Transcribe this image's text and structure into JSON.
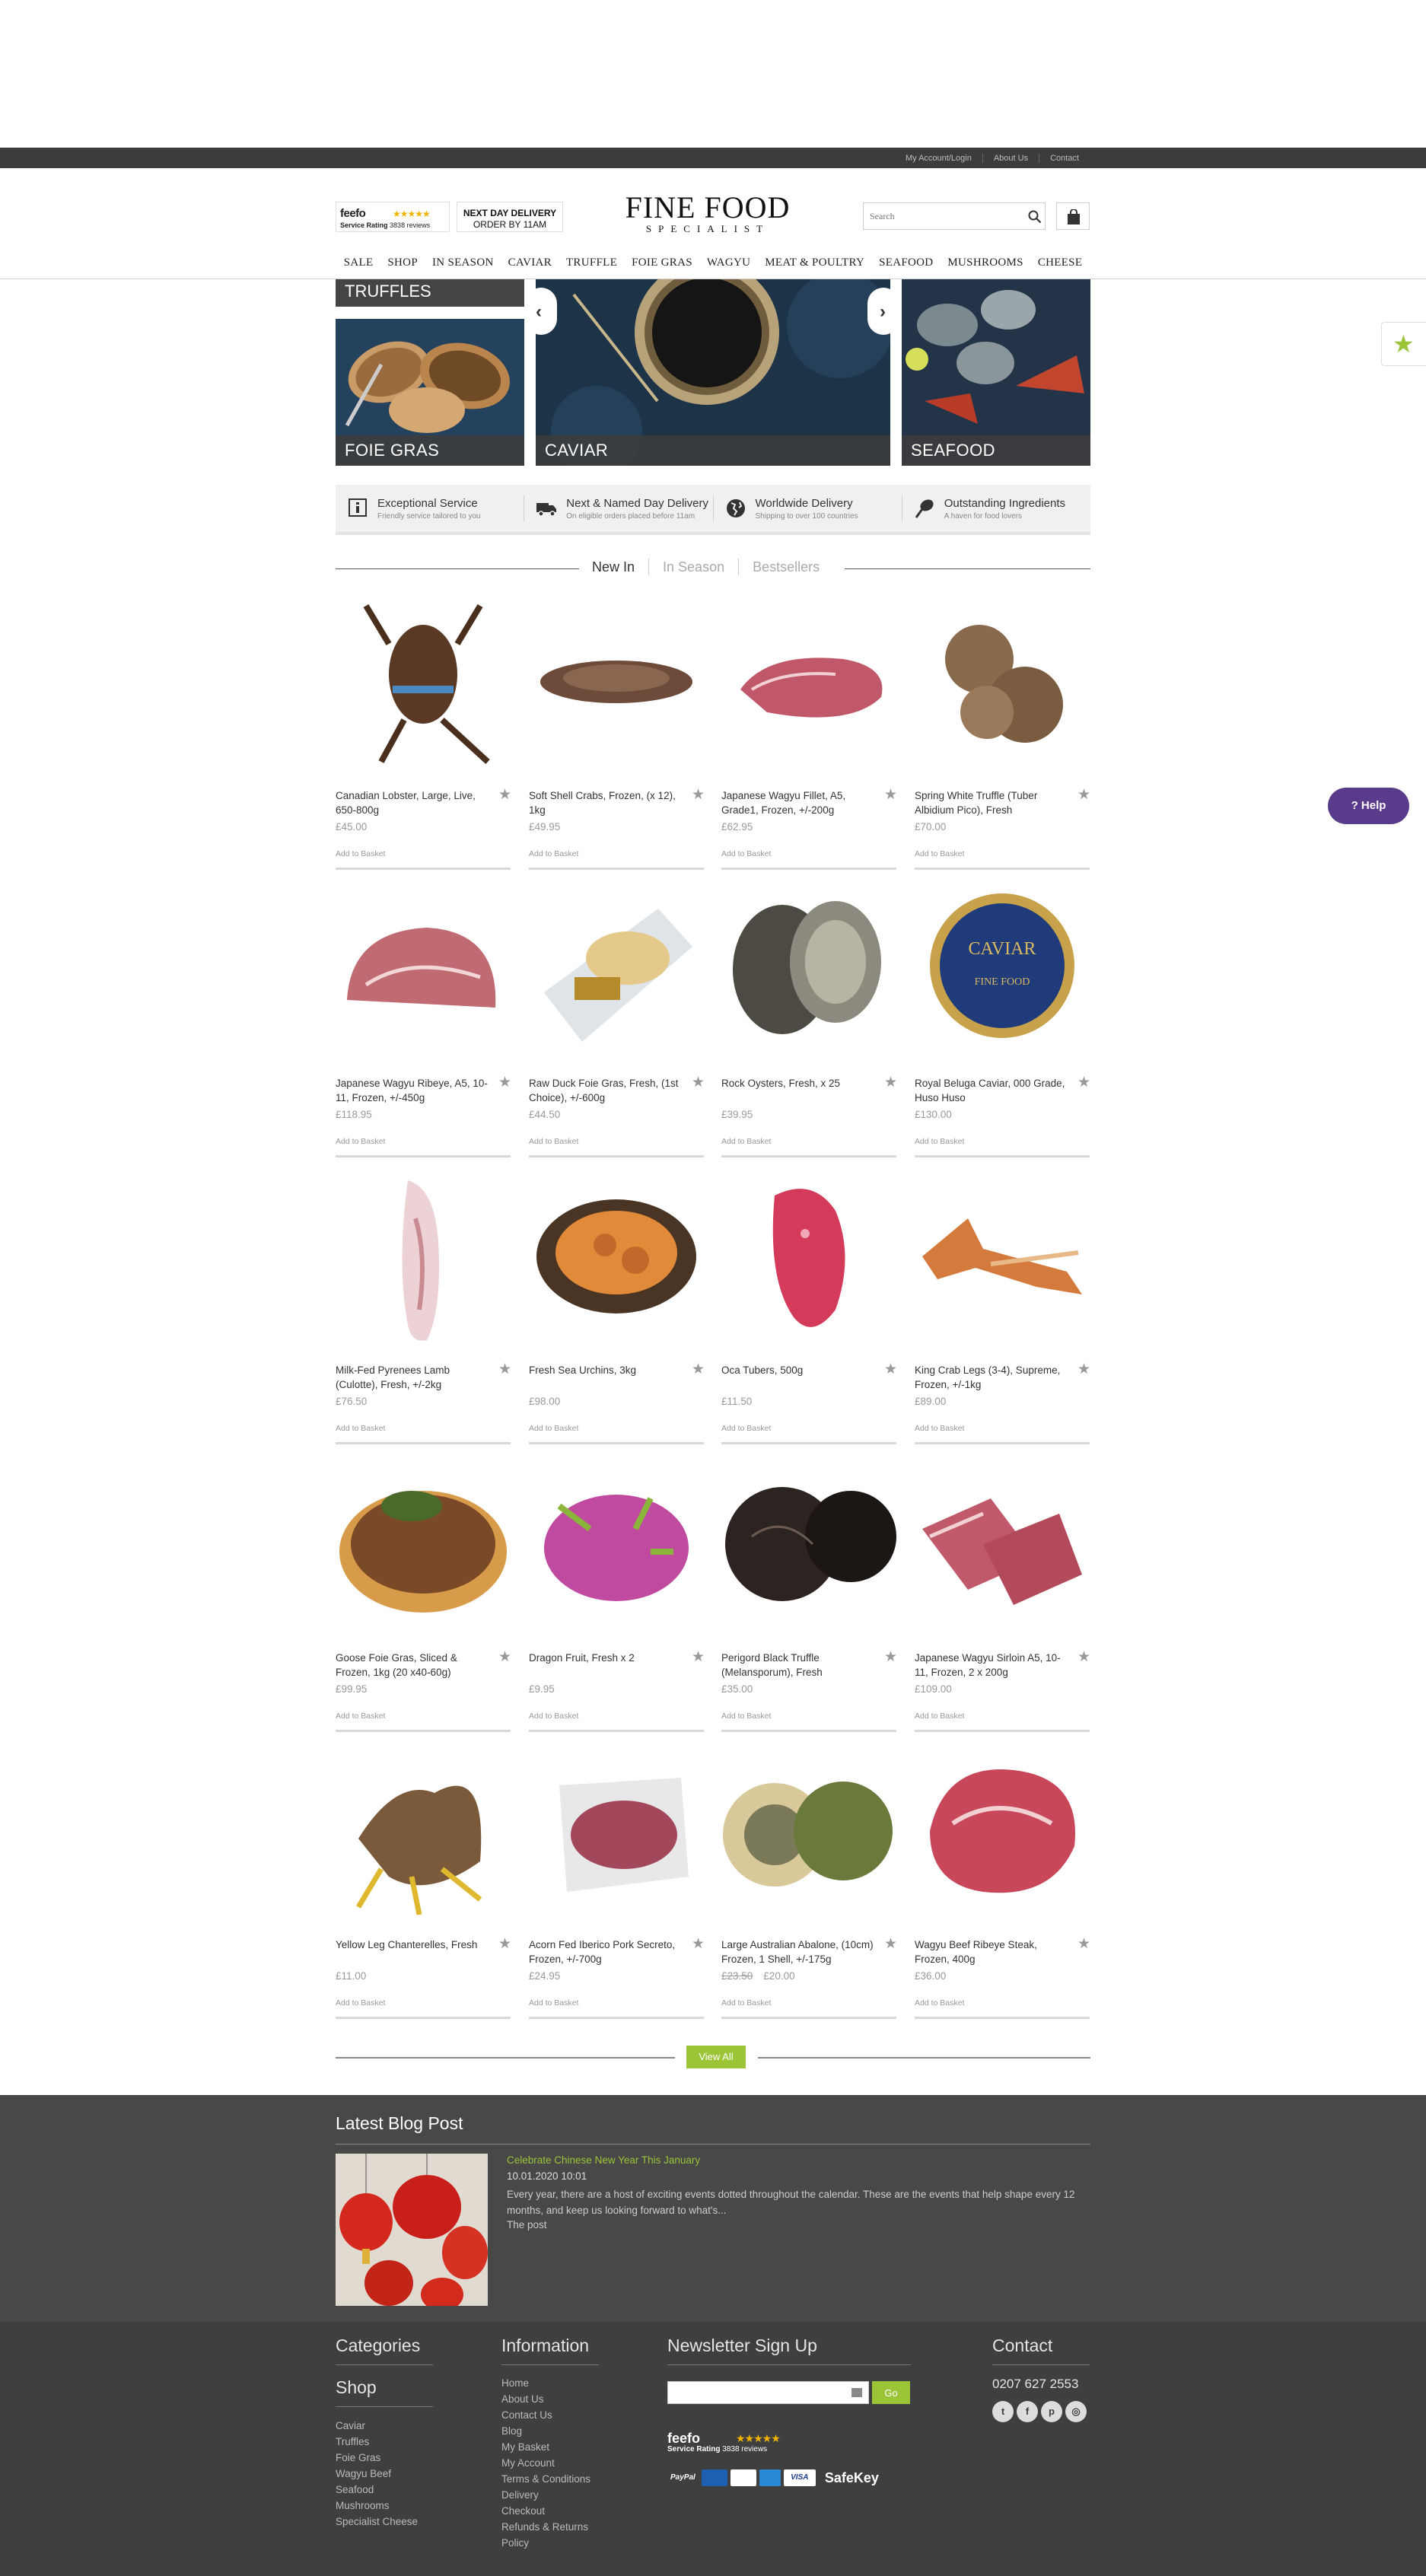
{
  "topbar": {
    "links": [
      "My Account/Login",
      "About Us",
      "Contact"
    ]
  },
  "header": {
    "feefo": {
      "logo": "feefo",
      "stars": "★★★★★",
      "rating": "Service Rating",
      "reviews": "3838 reviews"
    },
    "delivery": {
      "line1": "NEXT DAY DELIVERY",
      "line2": "ORDER BY 11AM"
    },
    "brand": {
      "name": "FINE FOOD",
      "sub": "SPECIALIST"
    },
    "search_placeholder": "Search"
  },
  "nav": [
    "SALE",
    "SHOP",
    "IN SEASON",
    "CAVIAR",
    "TRUFFLE",
    "FOIE GRAS",
    "WAGYU",
    "MEAT & POULTRY",
    "SEAFOOD",
    "MUSHROOMS",
    "CHEESE"
  ],
  "hero": {
    "truffles": "TRUFFLES",
    "foie": "FOIE GRAS",
    "caviar": "CAVIAR",
    "seafood": "SEAFOOD"
  },
  "usp": [
    {
      "title": "Exceptional Service",
      "sub": "Friendly service tailored to you",
      "icon": "info-icon"
    },
    {
      "title": "Next & Named Day Delivery",
      "sub": "On eligible orders placed before 11am",
      "icon": "truck-icon"
    },
    {
      "title": "Worldwide Delivery",
      "sub": "Shipping to over 100 countries",
      "icon": "globe-icon"
    },
    {
      "title": "Outstanding Ingredients",
      "sub": "A haven for food lovers",
      "icon": "whisk-icon"
    }
  ],
  "tabs": [
    "New In",
    "In Season",
    "Bestsellers"
  ],
  "products": [
    {
      "name": "Canadian Lobster, Large, Live, 650-800g",
      "price": "£45.00",
      "add": "Add to Basket"
    },
    {
      "name": "Soft Shell Crabs, Frozen, (x 12), 1kg",
      "price": "£49.95",
      "add": "Add to Basket"
    },
    {
      "name": "Japanese Wagyu Fillet, A5, Grade1, Frozen, +/-200g",
      "price": "£62.95",
      "add": "Add to Basket"
    },
    {
      "name": "Spring White Truffle (Tuber Albidium Pico), Fresh",
      "price": "£70.00",
      "add": "Add to Basket"
    },
    {
      "name": "Japanese Wagyu Ribeye, A5, 10-11, Frozen, +/-450g",
      "price": "£118.95",
      "add": "Add to Basket"
    },
    {
      "name": "Raw Duck Foie Gras, Fresh, (1st Choice), +/-600g",
      "price": "£44.50",
      "add": "Add to Basket"
    },
    {
      "name": "Rock Oysters, Fresh, x 25",
      "price": "£39.95",
      "add": "Add to Basket"
    },
    {
      "name": "Royal Beluga Caviar, 000 Grade, Huso Huso",
      "price": "£130.00",
      "add": "Add to Basket"
    },
    {
      "name": "Milk-Fed Pyrenees Lamb (Culotte), Fresh, +/-2kg",
      "price": "£76.50",
      "add": "Add to Basket"
    },
    {
      "name": "Fresh Sea Urchins, 3kg",
      "price": "£98.00",
      "add": "Add to Basket"
    },
    {
      "name": "Oca Tubers, 500g",
      "price": "£11.50",
      "add": "Add to Basket"
    },
    {
      "name": "King Crab Legs (3-4), Supreme, Frozen, +/-1kg",
      "price": "£89.00",
      "add": "Add to Basket"
    },
    {
      "name": "Goose Foie Gras, Sliced & Frozen, 1kg (20 x40-60g)",
      "price": "£99.95",
      "add": "Add to Basket"
    },
    {
      "name": "Dragon Fruit, Fresh x 2",
      "price": "£9.95",
      "add": "Add to Basket"
    },
    {
      "name": "Perigord Black Truffle (Melansporum), Fresh",
      "price": "£35.00",
      "add": "Add to Basket"
    },
    {
      "name": "Japanese Wagyu Sirloin A5, 10-11, Frozen, 2 x 200g",
      "price": "£109.00",
      "add": "Add to Basket"
    },
    {
      "name": "Yellow Leg Chanterelles, Fresh",
      "price": "£11.00",
      "add": "Add to Basket"
    },
    {
      "name": "Acorn Fed Iberico Pork Secreto, Frozen, +/-700g",
      "price": "£24.95",
      "add": "Add to Basket"
    },
    {
      "name": "Large Australian Abalone, (10cm) Frozen, 1 Shell, +/-175g",
      "old_price": "£23.50",
      "price": "£20.00",
      "add": "Add to Basket"
    },
    {
      "name": "Wagyu Beef Ribeye Steak, Frozen, 400g",
      "price": "£36.00",
      "add": "Add to Basket"
    }
  ],
  "view_all": "View All",
  "blog": {
    "heading": "Latest Blog Post",
    "title": "Celebrate Chinese New Year This January",
    "date": "10.01.2020 10:01",
    "excerpt": "Every year, there are a host of exciting events dotted throughout the calendar. These are the events that help shape every 12 months, and keep us looking forward to what's...",
    "more": "The post"
  },
  "footer": {
    "categories": "Categories",
    "shop": "Shop",
    "shop_items": [
      "Caviar",
      "Truffles",
      "Foie Gras",
      "Wagyu Beef",
      "Seafood",
      "Mushrooms",
      "Specialist Cheese"
    ],
    "information": "Information",
    "info_items": [
      "Home",
      "About Us",
      "Contact Us",
      "Blog",
      "My Basket",
      "My Account",
      "Terms & Conditions",
      "Delivery",
      "Checkout",
      "Refunds & Returns",
      "Policy"
    ],
    "newsletter": "Newsletter Sign Up",
    "go": "Go",
    "feefo": {
      "logo": "feefo",
      "stars": "★★★★★",
      "rating": "Service Rating",
      "reviews": "3838 reviews"
    },
    "payments": [
      "PayPal",
      "Maestro",
      "Mastercard",
      "Amex",
      "VISA"
    ],
    "safekey": "SafeKey",
    "contact": "Contact",
    "phone": "0207 627 2553",
    "socials": [
      "twitter-icon",
      "facebook-icon",
      "pinterest-icon",
      "instagram-icon"
    ]
  },
  "help": "Help",
  "colors": {
    "accent": "#9bc437",
    "dark": "#3c3c3c",
    "help": "#5a3a8a"
  }
}
